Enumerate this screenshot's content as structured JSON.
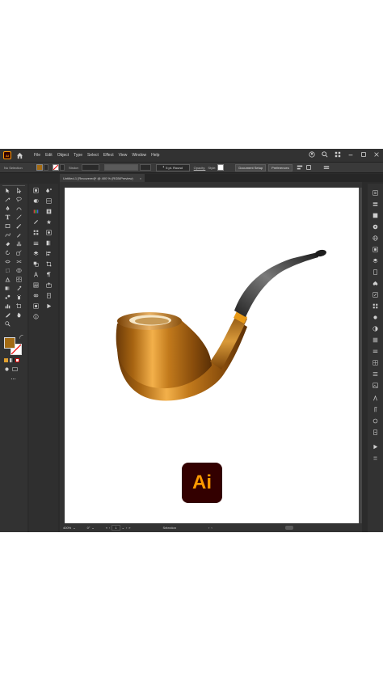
{
  "app": {
    "badge": "Ai",
    "menu": [
      "File",
      "Edit",
      "Object",
      "Type",
      "Select",
      "Effect",
      "View",
      "Window",
      "Help"
    ]
  },
  "control_bar": {
    "selection_status": "No Selection",
    "stroke_label": "Stroke:",
    "brush_label": "5 pt. Round",
    "opacity_label": "Opacity:",
    "style_label": "Style:",
    "document_setup": "Document Setup",
    "preferences": "Preferences"
  },
  "document_tab": {
    "title": "Untitled-1 [Recovered]* @ 400 % (RGB/Preview)",
    "close": "×"
  },
  "artwork": {
    "logo_text": "Ai"
  },
  "status_bar": {
    "zoom": "400%",
    "rotation": "0°",
    "artboard": "1",
    "tool": "Selection"
  },
  "colors": {
    "accent": "#ff9a00",
    "logo_bg": "#330000",
    "fill_swatch": "#a36a12",
    "ui_bg": "#2b2b2b"
  },
  "icons": [
    "home-icon",
    "search-icon",
    "account-icon",
    "arrange-icon",
    "minimize-icon",
    "maximize-icon",
    "close-icon"
  ]
}
